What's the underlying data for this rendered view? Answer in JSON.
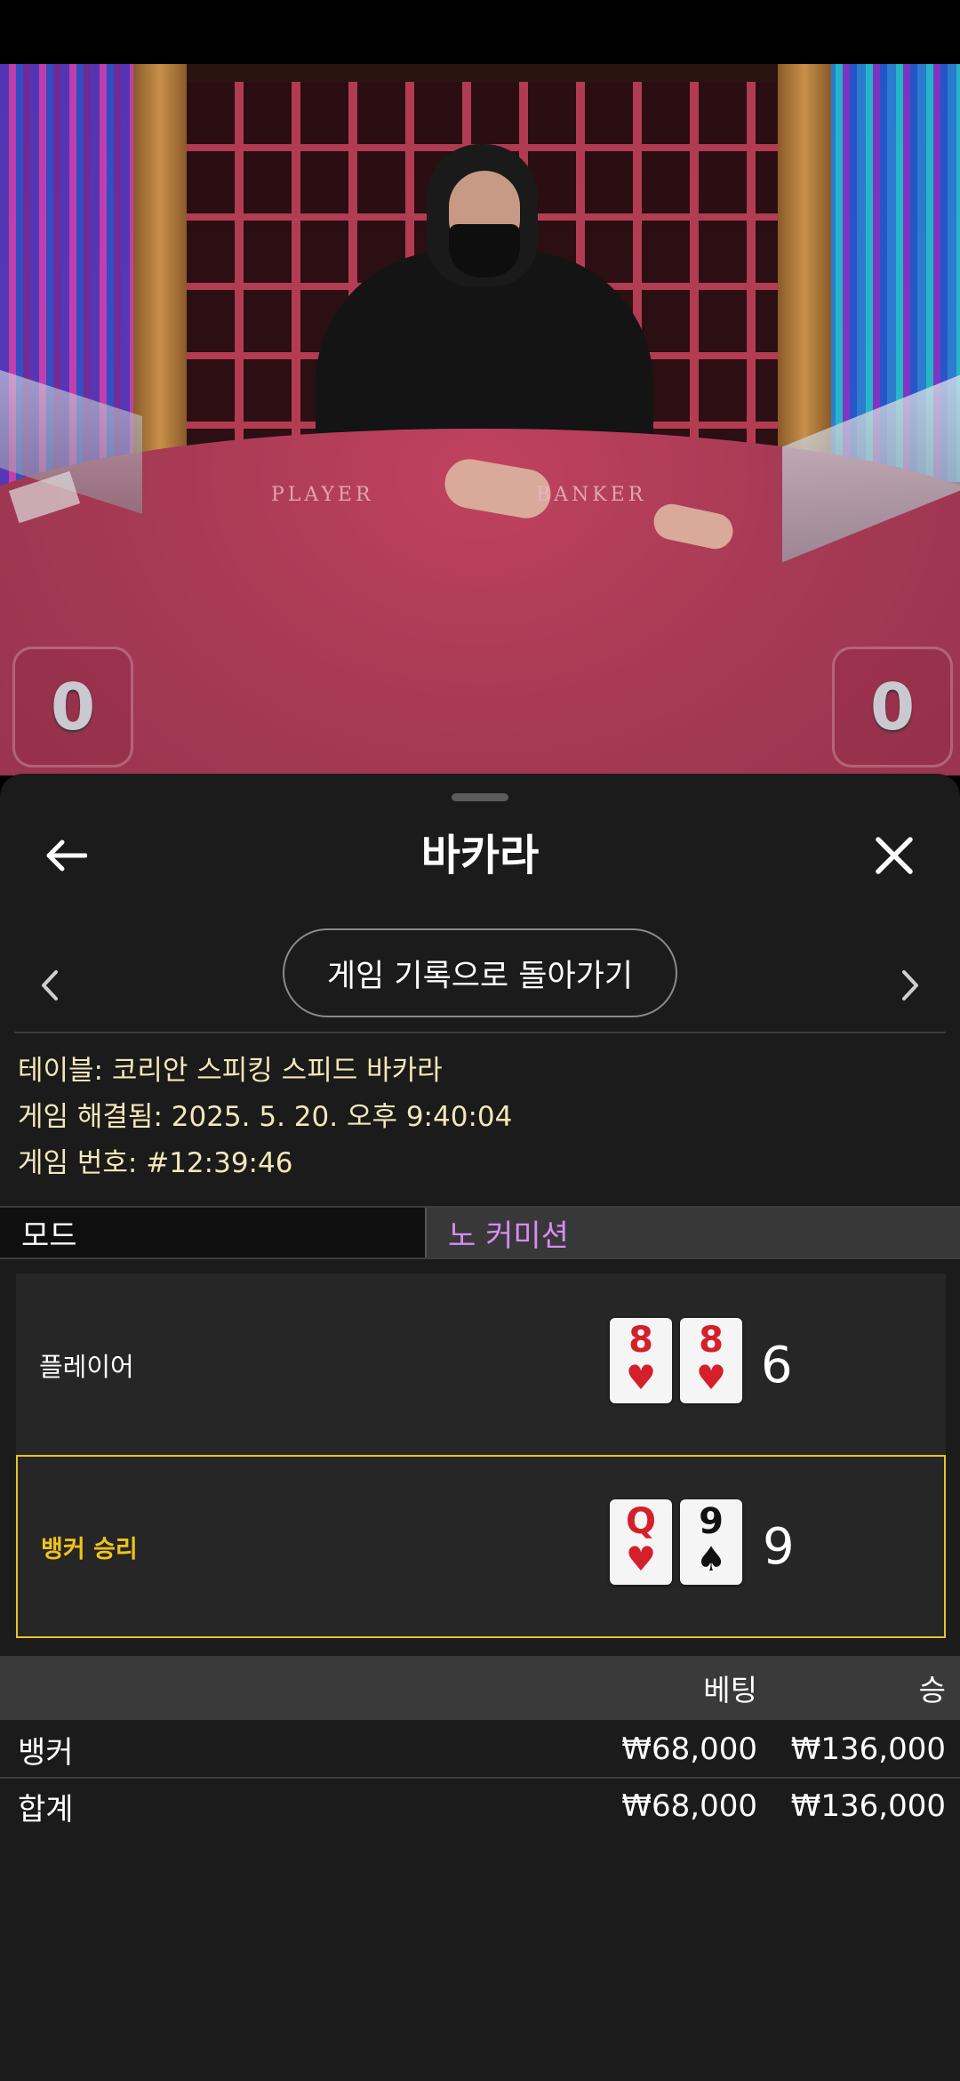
{
  "video": {
    "table_labels": {
      "player": "PLAYER",
      "banker": "BANKER"
    },
    "player_score": "0",
    "banker_score": "0"
  },
  "sheet": {
    "title": "바카라",
    "back_icon": "arrow-left-icon",
    "close_icon": "close-icon",
    "history_button": "게임 기록으로 돌아가기",
    "info": {
      "table": "테이블: 코리안 스피킹 스피드 바카라",
      "resolved": "게임 해결됨: 2025. 5. 20. 오후 9:40:04",
      "game_number": "게임 번호: #12:39:46"
    },
    "mode": {
      "label": "모드",
      "value": "노 커미션"
    },
    "hands": {
      "player": {
        "label": "플레이어",
        "cards": [
          {
            "rank": "8",
            "suit": "♥"
          },
          {
            "rank": "8",
            "suit": "♥"
          }
        ],
        "score": "6"
      },
      "banker": {
        "label": "뱅커 승리",
        "cards": [
          {
            "rank": "Q",
            "suit": "♥"
          },
          {
            "rank": "9",
            "suit": "♠"
          }
        ],
        "score": "9"
      }
    },
    "bets": {
      "header": {
        "bet": "베팅",
        "win": "승"
      },
      "rows": [
        {
          "name": "뱅커",
          "bet": "₩68,000",
          "win": "₩136,000"
        }
      ],
      "total": {
        "name": "합계",
        "bet": "₩68,000",
        "win": "₩136,000"
      }
    }
  },
  "colors": {
    "sheet_bg": "#1b1b1b",
    "info_text": "#f3e7b8",
    "mode_value": "#d58cf2",
    "banker_win": "#f0c318",
    "card_red": "#d3202a"
  }
}
